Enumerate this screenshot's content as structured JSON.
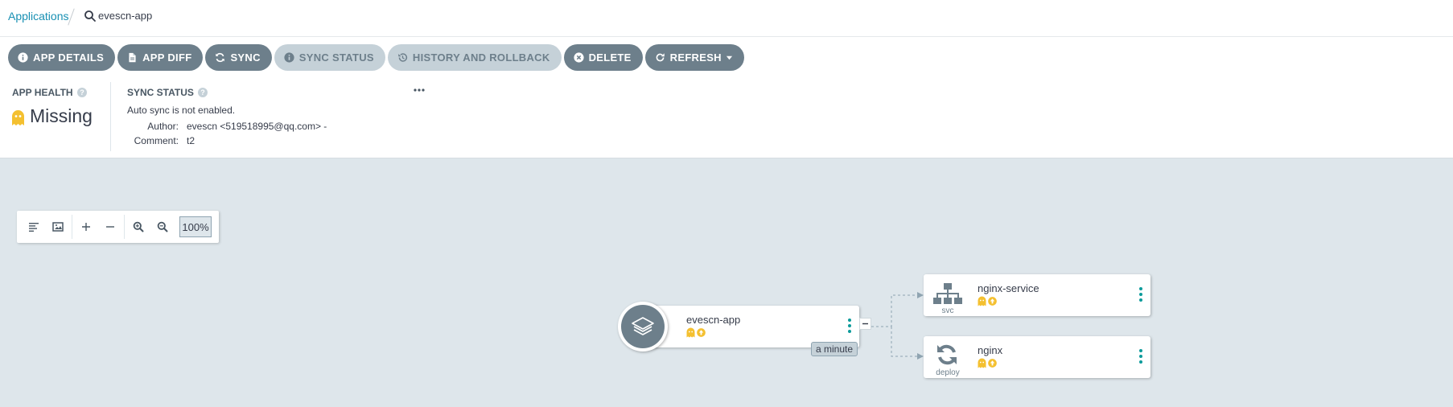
{
  "breadcrumb": {
    "root_label": "Applications",
    "current_label": "evescn-app"
  },
  "toolbar": {
    "buttons": [
      {
        "label": "APP DETAILS",
        "icon": "info-circle-icon",
        "enabled": true
      },
      {
        "label": "APP DIFF",
        "icon": "file-icon",
        "enabled": true
      },
      {
        "label": "SYNC",
        "icon": "sync-icon",
        "enabled": true
      },
      {
        "label": "SYNC STATUS",
        "icon": "info-circle-icon",
        "enabled": false
      },
      {
        "label": "HISTORY AND ROLLBACK",
        "icon": "history-icon",
        "enabled": false
      },
      {
        "label": "DELETE",
        "icon": "times-circle-icon",
        "enabled": true
      },
      {
        "label": "REFRESH",
        "icon": "redo-icon",
        "enabled": true
      }
    ]
  },
  "status_panel": {
    "health": {
      "title": "APP HEALTH",
      "value": "Missing",
      "icon": "ghost-icon",
      "color": "#f4c030"
    },
    "sync": {
      "title": "SYNC STATUS",
      "auto_sync": "Auto sync is not enabled.",
      "author_label": "Author:",
      "author_value": "evescn <519518995@qq.com> -",
      "comment_label": "Comment:",
      "comment_value": "t2"
    }
  },
  "graph_tools": {
    "zoom_level": "100%",
    "icons": [
      "align-left-icon",
      "image-icon",
      "plus-icon",
      "minus-icon",
      "zoom-in-icon",
      "zoom-out-icon"
    ]
  },
  "graph": {
    "app_node": {
      "name": "evescn-app",
      "age": "a minute",
      "icon": "layers-icon"
    },
    "resources": [
      {
        "name": "nginx-service",
        "kind": "svc",
        "icon": "sitemap-icon"
      },
      {
        "name": "nginx",
        "kind": "deploy",
        "icon": "sync-circle-icon"
      }
    ]
  },
  "colors": {
    "accent": "#1890b3",
    "button": "#6d7f8b",
    "button_disabled": "#c5d1d8",
    "missing": "#f4c030",
    "outofsync": "#f4c030",
    "graph_bg": "#dee6eb",
    "menu_teal": "#0dadea"
  }
}
